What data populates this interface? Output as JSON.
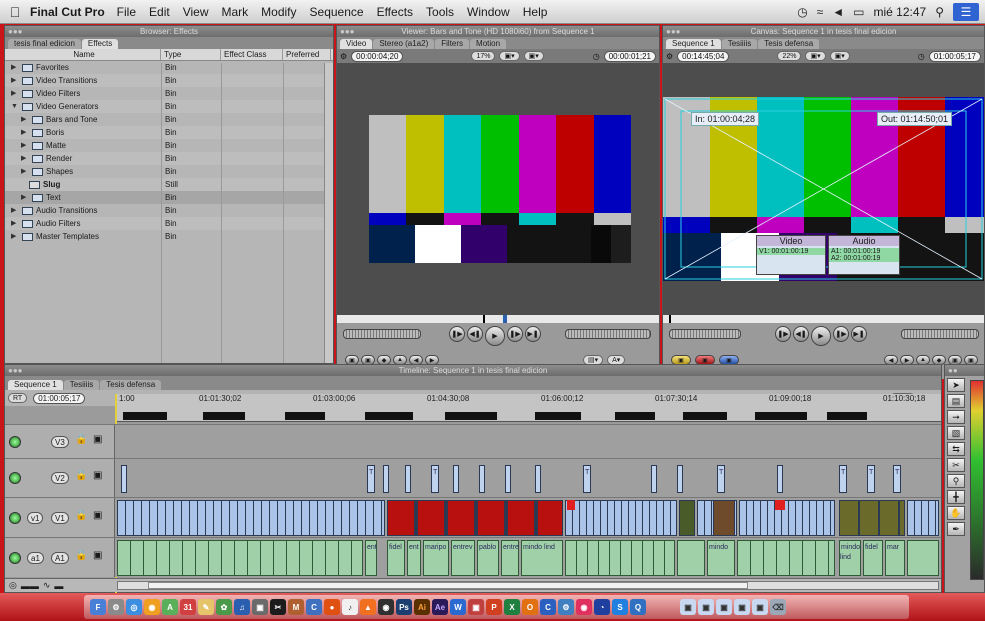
{
  "menubar": {
    "app_name": "Final Cut Pro",
    "menus": [
      "File",
      "Edit",
      "View",
      "Mark",
      "Modify",
      "Sequence",
      "Effects",
      "Tools",
      "Window",
      "Help"
    ],
    "clock": "mié 12:47"
  },
  "browser": {
    "title": "Browser: Effects",
    "tabs": [
      "tesis final edicion",
      "Effects"
    ],
    "columns": [
      "Name",
      "Type",
      "Effect Class",
      "Preferred"
    ],
    "rows": [
      {
        "name": "Favorites",
        "type": "Bin"
      },
      {
        "name": "Video Transitions",
        "type": "Bin"
      },
      {
        "name": "Video Filters",
        "type": "Bin"
      },
      {
        "name": "Video Generators",
        "type": "Bin"
      },
      {
        "name": "Bars and Tone",
        "type": "Bin"
      },
      {
        "name": "Boris",
        "type": "Bin"
      },
      {
        "name": "Matte",
        "type": "Bin"
      },
      {
        "name": "Render",
        "type": "Bin"
      },
      {
        "name": "Shapes",
        "type": "Bin"
      },
      {
        "name": "Slug",
        "type": "Still"
      },
      {
        "name": "Text",
        "type": "Bin"
      },
      {
        "name": "Audio Transitions",
        "type": "Bin"
      },
      {
        "name": "Audio Filters",
        "type": "Bin"
      },
      {
        "name": "Master Templates",
        "type": "Bin"
      }
    ]
  },
  "viewer": {
    "title": "Viewer: Bars and Tone (HD 1080i60) from Sequence 1",
    "tabs": [
      "Video",
      "Stereo (a1a2)",
      "Filters",
      "Motion"
    ],
    "timecode_current": "00:00:04;20",
    "zoom": "17%",
    "timecode_duration": "00:00:01;21"
  },
  "canvas": {
    "title": "Canvas: Sequence 1 in tesis final edicion",
    "tabs": [
      "Sequence 1",
      "Tesiiiis",
      "Tesis defensa"
    ],
    "timecode_current": "00:14:45;04",
    "zoom": "22%",
    "timecode_duration": "01:00:05;17",
    "in_point": "In: 01:00:04;28",
    "out_point": "Out: 01:14:50;01",
    "overlay_video_label": "Video",
    "overlay_audio_label": "Audio",
    "overlay_v1": "V1: 00:01:00:19",
    "overlay_a1": "A1: 00:01:00:19",
    "overlay_a2": "A2: 00:01:00:19"
  },
  "timeline": {
    "title": "Timeline: Sequence 1 in tesis final edicion",
    "tabs": [
      "Sequence 1",
      "Tesiiiis",
      "Tesis defensa"
    ],
    "rt_label": "RT",
    "timecode": "01:00:05;17",
    "ruler_ticks": [
      "1:00",
      "01:01:30;02",
      "01:03:00;06",
      "01:04:30;08",
      "01:06:00;12",
      "01:07:30;14",
      "01:09:00;18",
      "01:10:30;18"
    ],
    "tracks": {
      "v3": {
        "source": "",
        "target": "V3"
      },
      "v2": {
        "source": "",
        "target": "V2"
      },
      "v1": {
        "source": "v1",
        "target": "V1"
      },
      "a1": {
        "source": "a1",
        "target": "A1"
      }
    },
    "audio_clip_labels": [
      "ent",
      "fidel",
      "ent",
      "maripo",
      "entrev",
      "pablo",
      "entre",
      "mindo lind",
      "mindo",
      "fidel",
      "mar"
    ],
    "text_clip_labels": [
      "T",
      "T",
      "T",
      "T",
      "T",
      "T",
      "T"
    ]
  },
  "colors": {
    "desktop": "#c9141a",
    "selection": "#3b6fd6",
    "video_clip": "#a9c4e8",
    "audio_clip": "#9fd0a8"
  }
}
